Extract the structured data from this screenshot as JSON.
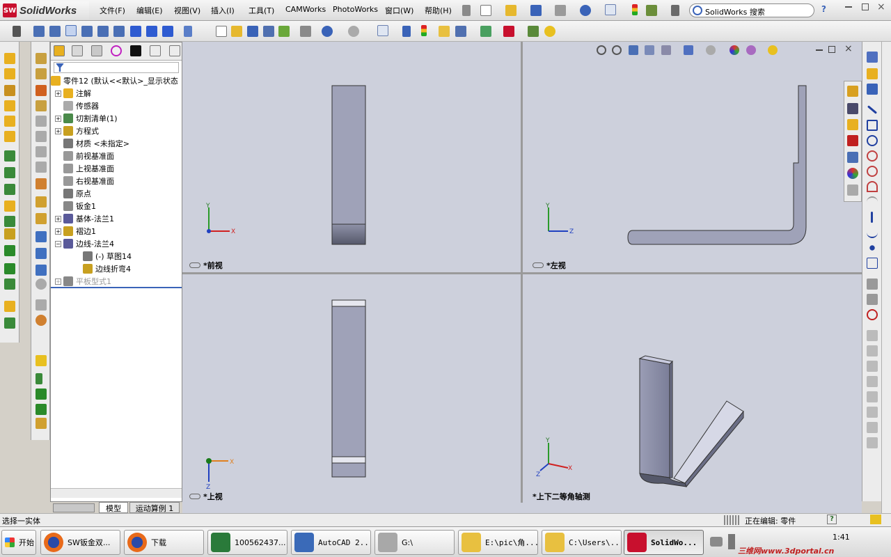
{
  "app": {
    "logo": "SolidWorks",
    "logo_mark": "SW"
  },
  "menu": [
    "文件(F)",
    "编辑(E)",
    "视图(V)",
    "插入(I)",
    "工具(T)",
    "CAMWorks",
    "PhotoWorks",
    "窗口(W)",
    "帮助(H)"
  ],
  "search": {
    "value": "SolidWorks 搜索",
    "help": "?"
  },
  "feature_tree": {
    "root": "零件12  (默认<<默认>_显示状态",
    "items": [
      {
        "label": "注解",
        "expand": "+"
      },
      {
        "label": "传感器",
        "expand": ""
      },
      {
        "label": "切割清单(1)",
        "expand": "+"
      },
      {
        "label": "方程式",
        "expand": "+"
      },
      {
        "label": "材质 <未指定>",
        "expand": ""
      },
      {
        "label": "前视基准面",
        "expand": ""
      },
      {
        "label": "上视基准面",
        "expand": ""
      },
      {
        "label": "右视基准面",
        "expand": ""
      },
      {
        "label": "原点",
        "expand": ""
      },
      {
        "label": "钣金1",
        "expand": ""
      },
      {
        "label": "基体-法兰1",
        "expand": "+"
      },
      {
        "label": "褶边1",
        "expand": "+"
      },
      {
        "label": "边线-法兰4",
        "expand": "−"
      },
      {
        "label": "(-) 草图14",
        "expand": "",
        "indent": 2
      },
      {
        "label": "边线折弯4",
        "expand": "",
        "indent": 2
      },
      {
        "label": "平板型式1",
        "expand": "+",
        "disabled": true
      }
    ],
    "bottom_tabs": [
      "模型",
      "运动算例 1"
    ]
  },
  "viewports": {
    "front": "*前视",
    "left": "*左视",
    "top": "*上视",
    "iso": "*上下二等角轴测",
    "axis": {
      "x": "X",
      "y": "Y",
      "z": "Z"
    }
  },
  "status": {
    "left": "选择一实体",
    "editing": "正在编辑: 零件",
    "help": "?"
  },
  "taskbar": {
    "start": "开始",
    "buttons": [
      "SW钣金双...",
      "下载",
      "100562437...",
      "AutoCAD 2...",
      "G:\\",
      "E:\\pic\\角...",
      "C:\\Users\\...",
      "SolidWo..."
    ],
    "clock": "1:41",
    "watermark": "三维网www.3dportal.cn"
  },
  "colors": {
    "viewport_bg": "#cdd0dc",
    "part": "#9fa2b8",
    "part_dark": "#6b6e86",
    "accent": "#c8102e"
  }
}
